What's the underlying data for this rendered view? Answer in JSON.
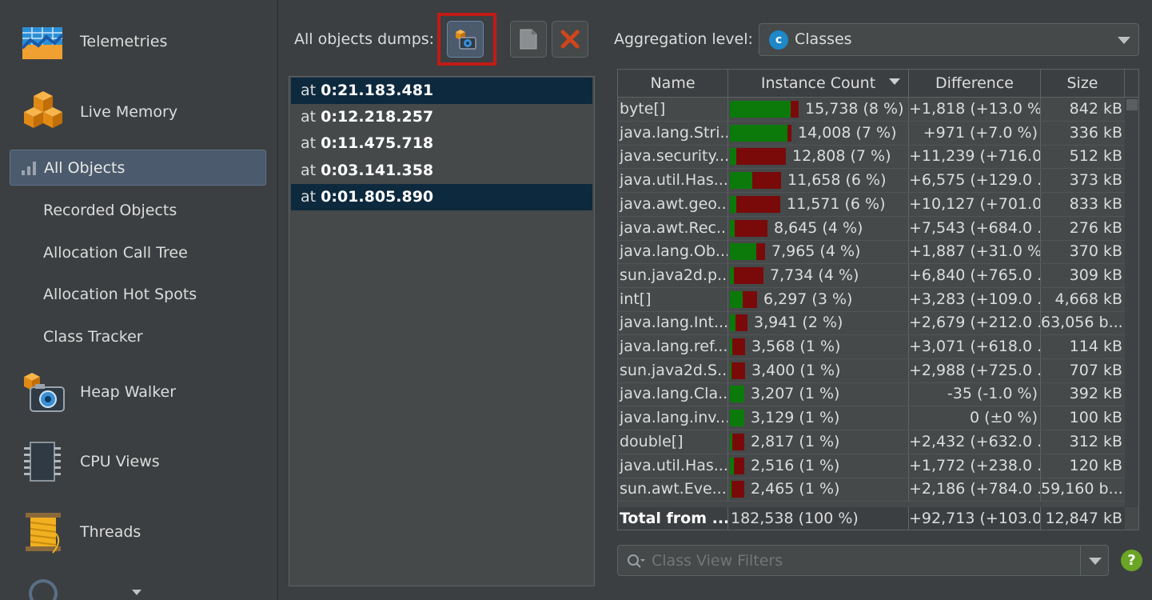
{
  "sidebar": {
    "telemetries": "Telemetries",
    "live_memory": "Live Memory",
    "all_objects": "All Objects",
    "recorded_objects": "Recorded Objects",
    "allocation_call_tree": "Allocation Call Tree",
    "allocation_hot_spots": "Allocation Hot Spots",
    "class_tracker": "Class Tracker",
    "heap_walker": "Heap Walker",
    "cpu_views": "CPU Views",
    "threads": "Threads"
  },
  "dumps": {
    "label": "All objects dumps:",
    "items": [
      {
        "prefix": "at ",
        "time": "0:21.183.481"
      },
      {
        "prefix": "at ",
        "time": "0:12.218.257"
      },
      {
        "prefix": "at ",
        "time": "0:11.475.718"
      },
      {
        "prefix": "at ",
        "time": "0:03.141.358"
      },
      {
        "prefix": "at ",
        "time": "0:01.805.890"
      }
    ]
  },
  "aggregation": {
    "label": "Aggregation level:",
    "badge": "c",
    "value": "Classes"
  },
  "table": {
    "headers": {
      "name": "Name",
      "count": "Instance Count",
      "diff": "Difference",
      "size": "Size"
    },
    "rows": [
      {
        "name": "byte[]",
        "count": "15,738 (8 %)",
        "diff": "+1,818 (+13.0 %)",
        "size": "842 kB",
        "green": 0.88,
        "red": 0.12
      },
      {
        "name": "java.lang.Stri...",
        "count": "14,008 (7 %)",
        "diff": "+971 (+7.0 %)",
        "size": "336 kB",
        "green": 0.93,
        "red": 0.07
      },
      {
        "name": "java.security...",
        "count": "12,808 (7 %)",
        "diff": "+11,239 (+716.0...",
        "size": "512 kB",
        "green": 0.12,
        "red": 0.88
      },
      {
        "name": "java.util.Has...",
        "count": "11,658 (6 %)",
        "diff": "+6,575 (+129.0 ...",
        "size": "373 kB",
        "green": 0.44,
        "red": 0.56
      },
      {
        "name": "java.awt.geo...",
        "count": "11,571 (6 %)",
        "diff": "+10,127 (+701.0...",
        "size": "833 kB",
        "green": 0.12,
        "red": 0.88
      },
      {
        "name": "java.awt.Rec...",
        "count": "8,645 (4 %)",
        "diff": "+7,543 (+684.0 ...",
        "size": "276 kB",
        "green": 0.12,
        "red": 0.88
      },
      {
        "name": "java.lang.Ob...",
        "count": "7,965 (4 %)",
        "diff": "+1,887 (+31.0 %)",
        "size": "370 kB",
        "green": 0.76,
        "red": 0.24
      },
      {
        "name": "sun.java2d.p...",
        "count": "7,734 (4 %)",
        "diff": "+6,840 (+765.0 ...",
        "size": "309 kB",
        "green": 0.12,
        "red": 0.88
      },
      {
        "name": "int[]",
        "count": "6,297 (3 %)",
        "diff": "+3,283 (+109.0 ...",
        "size": "4,668 kB",
        "green": 0.48,
        "red": 0.52
      },
      {
        "name": "java.lang.Int...",
        "count": "3,941 (2 %)",
        "diff": "+2,679 (+212.0 ...",
        "size": "63,056 b...",
        "green": 0.3,
        "red": 0.7
      },
      {
        "name": "java.lang.ref....",
        "count": "3,568 (1 %)",
        "diff": "+3,071 (+618.0 ...",
        "size": "114 kB",
        "green": 0.14,
        "red": 0.86
      },
      {
        "name": "sun.java2d.S...",
        "count": "3,400 (1 %)",
        "diff": "+2,988 (+725.0 ...",
        "size": "707 kB",
        "green": 0.12,
        "red": 0.88
      },
      {
        "name": "java.lang.Cla...",
        "count": "3,207 (1 %)",
        "diff": "-35 (-1.0 %)",
        "size": "392 kB",
        "green": 1.0,
        "red": 0.0
      },
      {
        "name": "java.lang.inv...",
        "count": "3,129 (1 %)",
        "diff": "0 (±0 %)",
        "size": "100 kB",
        "green": 1.0,
        "red": 0.0
      },
      {
        "name": "double[]",
        "count": "2,817 (1 %)",
        "diff": "+2,432 (+632.0 ...",
        "size": "312 kB",
        "green": 0.14,
        "red": 0.86
      },
      {
        "name": "java.util.Has...",
        "count": "2,516 (1 %)",
        "diff": "+1,772 (+238.0 ...",
        "size": "120 kB",
        "green": 0.3,
        "red": 0.7
      },
      {
        "name": "sun.awt.Eve...",
        "count": "2,465 (1 %)",
        "diff": "+2,186 (+784.0 ...",
        "size": "59,160 b...",
        "green": 0.12,
        "red": 0.88
      }
    ],
    "total": {
      "name": "Total from ...",
      "count": "182,538 (100 %)",
      "diff": "+92,713 (+103.0...",
      "size": "12,847 kB"
    }
  },
  "filter": {
    "placeholder": "Class View Filters"
  },
  "help": {
    "label": "?"
  },
  "colors": {
    "accent": "#4b5a6c",
    "bar_green": "#0b7a0b",
    "bar_red": "#7a0a0a",
    "highlight": "#c11b17"
  }
}
